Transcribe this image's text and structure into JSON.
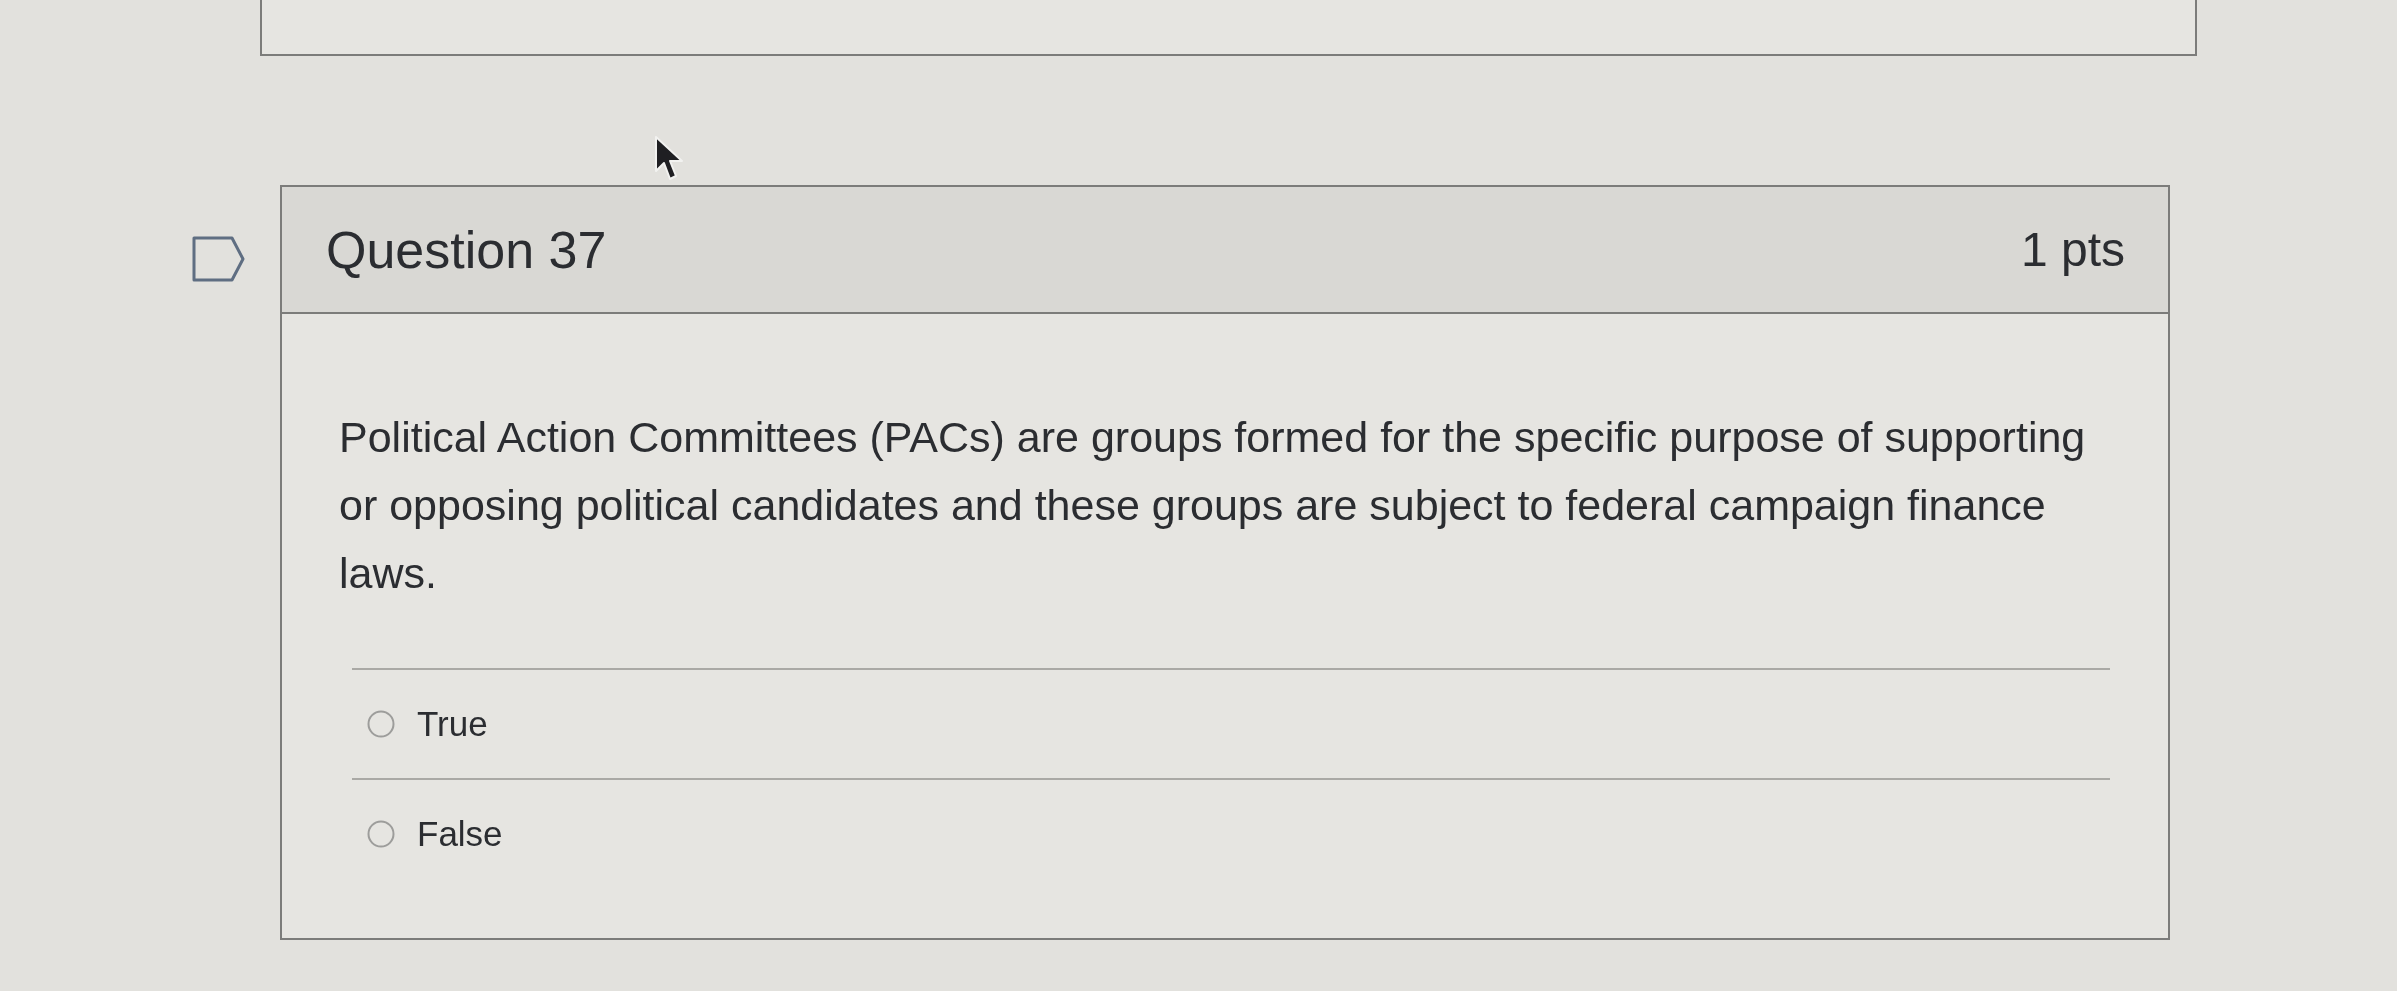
{
  "question": {
    "flagged": false,
    "title": "Question 37",
    "points": "1 pts",
    "text": "Political Action Committees (PACs) are groups formed for the specific purpose of supporting or opposing political candidates and these groups are subject to federal campaign finance laws.",
    "answers": [
      {
        "label": "True",
        "selected": false
      },
      {
        "label": "False",
        "selected": false
      }
    ]
  }
}
